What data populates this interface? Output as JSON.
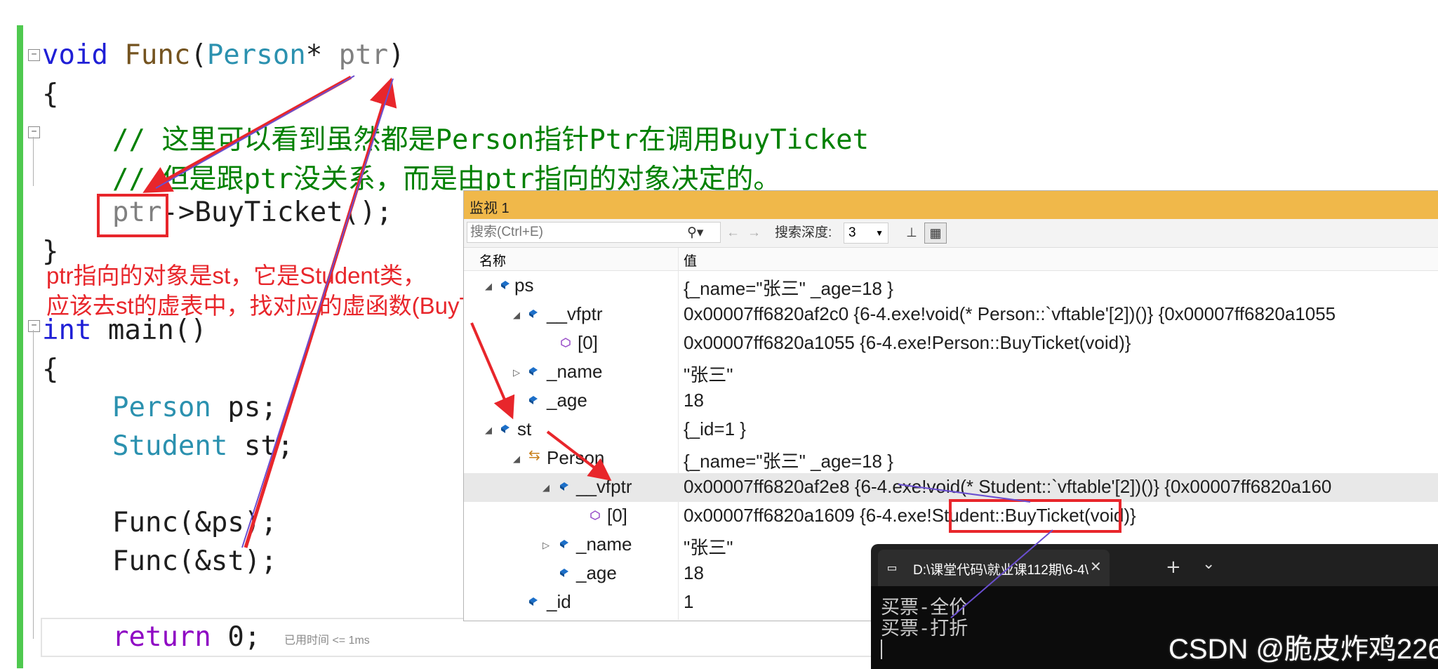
{
  "code": {
    "func_sig": {
      "kw": "void",
      "name": "Func",
      "paren_open": "(",
      "type": "Person",
      "star": "*",
      "param": "ptr",
      "paren_close": ")"
    },
    "brace_open_1": "{",
    "comment_1": "// 这里可以看到虽然都是Person指针Ptr在调用BuyTicket",
    "comment_2": "// 但是跟ptr没关系，而是由ptr指向的对象决定的。",
    "call_ptr": "ptr",
    "call_rest": "->BuyTicket();",
    "brace_close_1": "}",
    "main_kw": "int",
    "main_rest": " main()",
    "brace_open_2": "{",
    "decl_person_type": "Person",
    "decl_person_var": " ps;",
    "decl_student_type": "Student",
    "decl_student_var": " st;",
    "call_func_ps": "Func(&ps);",
    "call_func_st": "Func(&st);",
    "return_kw": "return",
    "return_rest": " 0;",
    "elapsed": "已用时间 <= 1ms"
  },
  "annotation": {
    "line1": "ptr指向的对象是st，它是Student类，",
    "line2": "应该去st的虚表中，找对应的虚函数(BuyTicket)"
  },
  "watch": {
    "title": "监视 1",
    "search_placeholder": "搜索(Ctrl+E)",
    "search_icon": "search-icon",
    "depth_label": "搜索深度:",
    "depth_value": "3",
    "col_name": "名称",
    "col_value": "值",
    "rows": [
      {
        "name": "ps",
        "value": "{_name=\"张三\" _age=18 }"
      },
      {
        "name": "__vfptr",
        "value": "0x00007ff6820af2c0 {6-4.exe!void(* Person::`vftable'[2])()} {0x00007ff6820a1055"
      },
      {
        "name": "[0]",
        "value": "0x00007ff6820a1055 {6-4.exe!Person::BuyTicket(void)}"
      },
      {
        "name": "_name",
        "value": "\"张三\""
      },
      {
        "name": "_age",
        "value": "18"
      },
      {
        "name": "st",
        "value": "{_id=1 }"
      },
      {
        "name": "Person",
        "value": "{_name=\"张三\" _age=18 }"
      },
      {
        "name": "__vfptr",
        "value": "0x00007ff6820af2e8 {6-4.exe!void(* Student::`vftable'[2])()} {0x00007ff6820a160"
      },
      {
        "name": "[0]",
        "value": "0x00007ff6820a1609 {6-4.exe!Student::BuyTicket(void)}"
      },
      {
        "name": "_name",
        "value": "\"张三\""
      },
      {
        "name": "_age",
        "value": "18"
      },
      {
        "name": "_id",
        "value": "1"
      }
    ]
  },
  "terminal": {
    "tab_title": "D:\\课堂代码\\就业课112期\\6-4\\",
    "close": "✕",
    "new_tab": "+",
    "dropdown": "⌄",
    "lines": [
      "买票-全价",
      "买票-打折"
    ]
  },
  "watermark": "CSDN @脆皮炸鸡226",
  "colors": {
    "annotation_red": "#e8262b",
    "watch_title": "#f0b84a",
    "comment_green": "#008000",
    "arrow_purple": "#6a4fd0"
  }
}
